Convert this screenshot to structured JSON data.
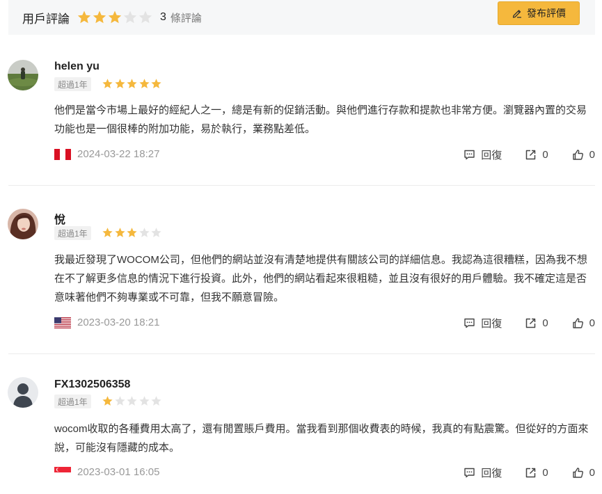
{
  "header": {
    "title": "用戶評論",
    "rating": 3,
    "count": "3",
    "count_label": "條評論",
    "post_button": "發布評價"
  },
  "colors": {
    "star_on": "#f5b83d",
    "star_off": "#e3e3e3",
    "accent": "#f5b83d"
  },
  "reviews": [
    {
      "username": "helen yu",
      "tenure": "超過1年",
      "rating": 5,
      "content": "他們是當今市場上最好的經紀人之一，總是有新的促銷活動。與他們進行存款和提款也非常方便。瀏覽器內置的交易功能也是一個很棒的附加功能，易於執行，業務點差低。",
      "flag": "peru",
      "date": "2024-03-22 18:27",
      "reply_label": "回復",
      "share_count": "0",
      "like_count": "0"
    },
    {
      "username": "悅",
      "tenure": "超過1年",
      "rating": 3,
      "content": "我最近發現了WOCOM公司，但他們的網站並沒有清楚地提供有關該公司的詳細信息。我認為這很糟糕，因為我不想在不了解更多信息的情況下進行投資。此外，他們的網站看起來很粗糙，並且沒有很好的用戶體驗。我不確定這是否意味著他們不夠專業或不可靠，但我不願意冒險。",
      "flag": "usa",
      "date": "2023-03-20 18:21",
      "reply_label": "回復",
      "share_count": "0",
      "like_count": "0"
    },
    {
      "username": "FX1302506358",
      "tenure": "超過1年",
      "rating": 1,
      "content": "wocom收取的各種費用太高了，還有閒置賬戶費用。當我看到那個收費表的時候，我真的有點震驚。但從好的方面來說，可能沒有隱藏的成本。",
      "flag": "singapore",
      "date": "2023-03-01 16:05",
      "reply_label": "回復",
      "share_count": "0",
      "like_count": "0"
    }
  ]
}
